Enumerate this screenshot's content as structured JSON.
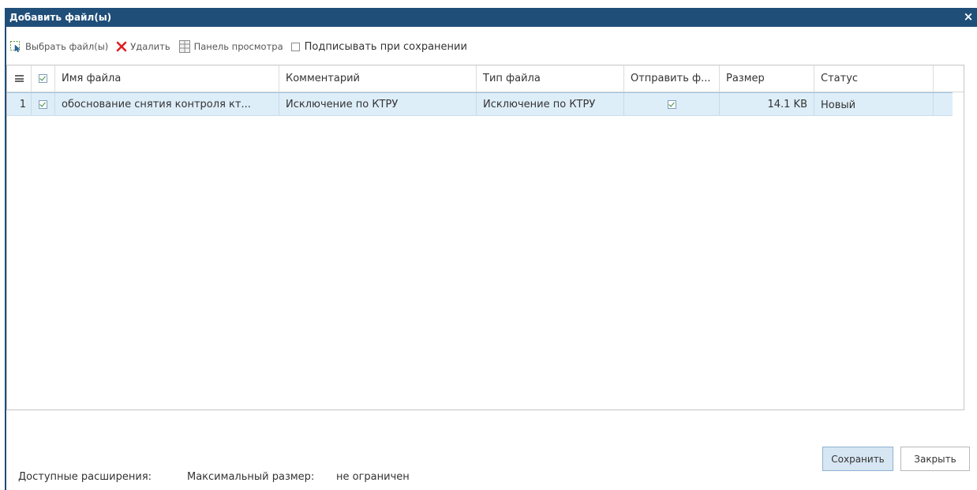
{
  "dialog": {
    "title": "Добавить файл(ы)",
    "close_symbol": "×"
  },
  "toolbar": {
    "select_files_label": "Выбрать файл(ы)",
    "delete_label": "Удалить",
    "preview_panel_label": "Панель просмотра",
    "sign_on_save_label": "Подписывать при сохранении",
    "sign_on_save_checked": false
  },
  "grid": {
    "columns": {
      "name": "Имя файла",
      "comment": "Комментарий",
      "file_type": "Тип файла",
      "send": "Отправить ф...",
      "size": "Размер",
      "status": "Статус"
    },
    "header_all_checked": true,
    "rows": [
      {
        "index": "1",
        "checked": true,
        "name": "обоснование снятия контроля кт...",
        "comment": "Исключение по КТРУ",
        "file_type": "Исключение по КТРУ",
        "send_checked": true,
        "size": "14.1 KB",
        "status": "Новый"
      }
    ]
  },
  "footer": {
    "extensions_label": "Доступные расширения:",
    "max_size_label": "Максимальный размер:",
    "max_size_value": "не ограничен",
    "save_button": "Сохранить",
    "close_button": "Закрыть"
  },
  "colors": {
    "titlebar": "#1f4e79",
    "selected_row": "#deeef9",
    "delete_icon": "#e02020",
    "check_green": "#3a8c3a"
  },
  "icons": {
    "select_files": "cursor-select-icon",
    "delete": "red-x-icon",
    "preview_panel": "panel-icon",
    "grid_menu": "hamburger-icon"
  }
}
